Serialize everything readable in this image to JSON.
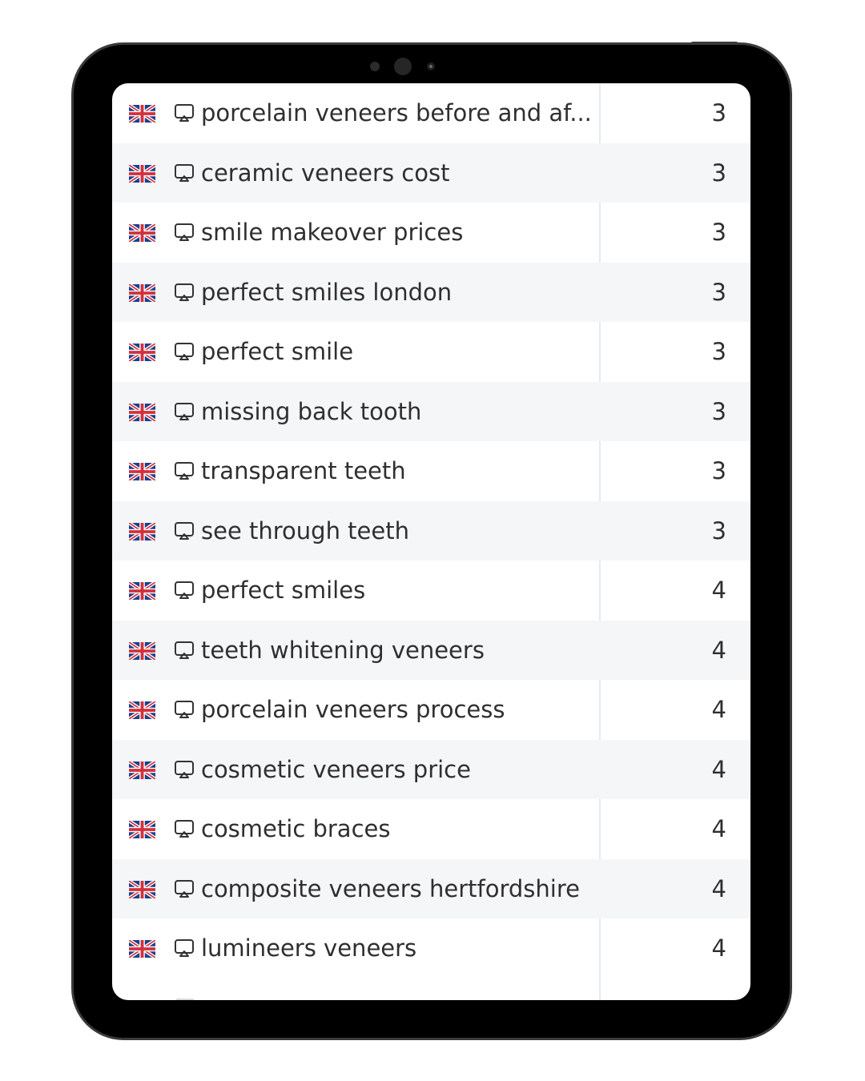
{
  "table": {
    "rows": [
      {
        "country": "uk-flag-icon",
        "keyword": "porcelain veneers before and af...",
        "value": "3"
      },
      {
        "country": "uk-flag-icon",
        "keyword": "ceramic veneers cost",
        "value": "3"
      },
      {
        "country": "uk-flag-icon",
        "keyword": "smile makeover prices",
        "value": "3"
      },
      {
        "country": "uk-flag-icon",
        "keyword": "perfect smiles london",
        "value": "3"
      },
      {
        "country": "uk-flag-icon",
        "keyword": "perfect smile",
        "value": "3"
      },
      {
        "country": "uk-flag-icon",
        "keyword": "missing back tooth",
        "value": "3"
      },
      {
        "country": "uk-flag-icon",
        "keyword": "transparent teeth",
        "value": "3"
      },
      {
        "country": "uk-flag-icon",
        "keyword": "see through teeth",
        "value": "3"
      },
      {
        "country": "uk-flag-icon",
        "keyword": "perfect smiles",
        "value": "4"
      },
      {
        "country": "uk-flag-icon",
        "keyword": "teeth whitening veneers",
        "value": "4"
      },
      {
        "country": "uk-flag-icon",
        "keyword": "porcelain veneers process",
        "value": "4"
      },
      {
        "country": "uk-flag-icon",
        "keyword": "cosmetic veneers price",
        "value": "4"
      },
      {
        "country": "uk-flag-icon",
        "keyword": "cosmetic braces",
        "value": "4"
      },
      {
        "country": "uk-flag-icon",
        "keyword": "composite veneers hertfordshire",
        "value": "4"
      },
      {
        "country": "uk-flag-icon",
        "keyword": "lumineers veneers",
        "value": "4"
      }
    ]
  },
  "colors": {
    "row_alt": "#f5f6f8",
    "text": "#2f2f2f",
    "divider": "#e6eaf0",
    "bezel": "#000000"
  },
  "icons": {
    "row_icon": "desktop-monitor-icon",
    "flag_icon": "uk-flag-icon"
  }
}
